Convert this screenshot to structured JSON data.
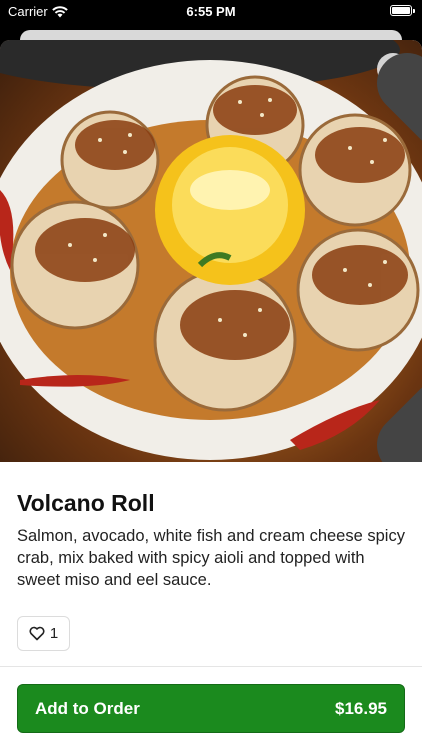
{
  "status_bar": {
    "carrier": "Carrier",
    "time": "6:55 PM",
    "wifi_icon": "wifi-icon",
    "battery_icon": "battery-icon"
  },
  "item": {
    "image_alt": "Volcano Roll photo",
    "name": "Volcano Roll",
    "description": "Salmon, avocado, white fish and cream cheese spicy crab, mix baked with spicy aioli and topped with sweet miso and eel sauce.",
    "likes": "1",
    "close_icon": "close-icon",
    "heart_icon": "heart-icon"
  },
  "order": {
    "label": "Add to Order",
    "price": "$16.95"
  },
  "colors": {
    "accent": "#1b8a1e",
    "background": "#ffffff"
  }
}
